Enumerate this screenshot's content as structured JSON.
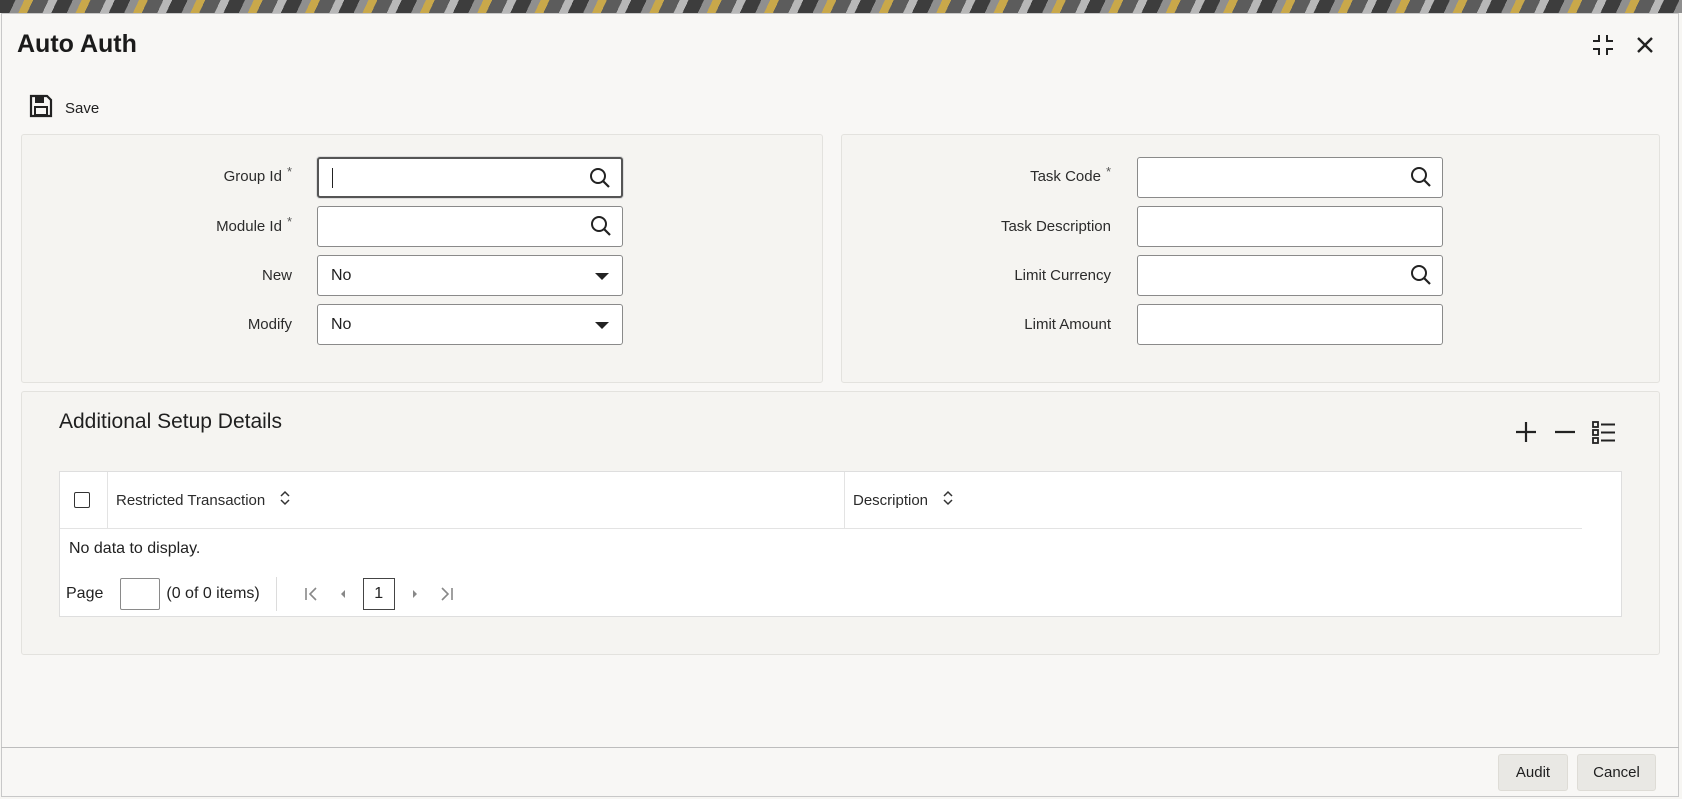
{
  "window": {
    "title": "Auto Auth"
  },
  "toolbar": {
    "save_label": "Save"
  },
  "form_left": {
    "group_id": {
      "label": "Group Id",
      "required": "*",
      "value": ""
    },
    "module_id": {
      "label": "Module Id",
      "required": "*",
      "value": ""
    },
    "new": {
      "label": "New",
      "value": "No"
    },
    "modify": {
      "label": "Modify",
      "value": "No"
    }
  },
  "form_right": {
    "task_code": {
      "label": "Task Code",
      "required": "*",
      "value": ""
    },
    "task_description": {
      "label": "Task Description",
      "value": ""
    },
    "limit_currency": {
      "label": "Limit Currency",
      "value": ""
    },
    "limit_amount": {
      "label": "Limit Amount",
      "value": ""
    }
  },
  "additional": {
    "title": "Additional Setup Details",
    "columns": [
      "Restricted Transaction",
      "Description"
    ],
    "rows": [],
    "empty_text": "No data to display.",
    "pager": {
      "page_label": "Page",
      "items_text": "(0 of 0 items)",
      "current_page": "1"
    }
  },
  "footer": {
    "audit_label": "Audit",
    "cancel_label": "Cancel"
  },
  "icons": [
    "save-icon",
    "maximize-icon",
    "close-icon",
    "search-icon",
    "dropdown-arrow-icon",
    "add-row-icon",
    "remove-row-icon",
    "single-view-icon",
    "sort-icon",
    "first-page-icon",
    "previous-page-icon",
    "next-page-icon",
    "last-page-icon"
  ]
}
